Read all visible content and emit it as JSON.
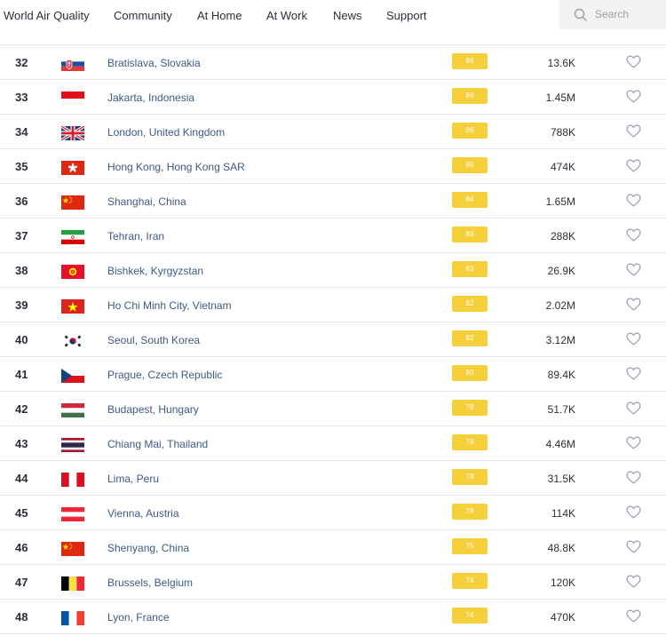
{
  "nav": {
    "items": [
      "World Air Quality",
      "Community",
      "At Home",
      "At Work",
      "News",
      "Support"
    ],
    "search_placeholder": "Search"
  },
  "colors": {
    "aqi_moderate": "#f5d03a",
    "city_link": "#3c5a85",
    "heart": "#9aa3b0"
  },
  "rows": [
    {
      "rank": "32",
      "flag": "slovakia",
      "city": "Bratislava, Slovakia",
      "aqi": "86",
      "followers": "13.6K"
    },
    {
      "rank": "33",
      "flag": "indonesia",
      "city": "Jakarta, Indonesia",
      "aqi": "86",
      "followers": "1.45M"
    },
    {
      "rank": "34",
      "flag": "united-kingdom",
      "city": "London, United Kingdom",
      "aqi": "86",
      "followers": "788K"
    },
    {
      "rank": "35",
      "flag": "hong-kong",
      "city": "Hong Kong, Hong Kong SAR",
      "aqi": "85",
      "followers": "474K"
    },
    {
      "rank": "36",
      "flag": "china",
      "city": "Shanghai, China",
      "aqi": "84",
      "followers": "1.65M"
    },
    {
      "rank": "37",
      "flag": "iran",
      "city": "Tehran, Iran",
      "aqi": "83",
      "followers": "288K"
    },
    {
      "rank": "38",
      "flag": "kyrgyzstan",
      "city": "Bishkek, Kyrgyzstan",
      "aqi": "83",
      "followers": "26.9K"
    },
    {
      "rank": "39",
      "flag": "vietnam",
      "city": "Ho Chi Minh City, Vietnam",
      "aqi": "82",
      "followers": "2.02M"
    },
    {
      "rank": "40",
      "flag": "south-korea",
      "city": "Seoul, South Korea",
      "aqi": "82",
      "followers": "3.12M"
    },
    {
      "rank": "41",
      "flag": "czech-republic",
      "city": "Prague, Czech Republic",
      "aqi": "80",
      "followers": "89.4K"
    },
    {
      "rank": "42",
      "flag": "hungary",
      "city": "Budapest, Hungary",
      "aqi": "79",
      "followers": "51.7K"
    },
    {
      "rank": "43",
      "flag": "thailand",
      "city": "Chiang Mai, Thailand",
      "aqi": "79",
      "followers": "4.46M"
    },
    {
      "rank": "44",
      "flag": "peru",
      "city": "Lima, Peru",
      "aqi": "78",
      "followers": "31.5K"
    },
    {
      "rank": "45",
      "flag": "austria",
      "city": "Vienna, Austria",
      "aqi": "78",
      "followers": "114K"
    },
    {
      "rank": "46",
      "flag": "china",
      "city": "Shenyang, China",
      "aqi": "75",
      "followers": "48.8K"
    },
    {
      "rank": "47",
      "flag": "belgium",
      "city": "Brussels, Belgium",
      "aqi": "74",
      "followers": "120K"
    },
    {
      "rank": "48",
      "flag": "france",
      "city": "Lyon, France",
      "aqi": "74",
      "followers": "470K"
    }
  ]
}
